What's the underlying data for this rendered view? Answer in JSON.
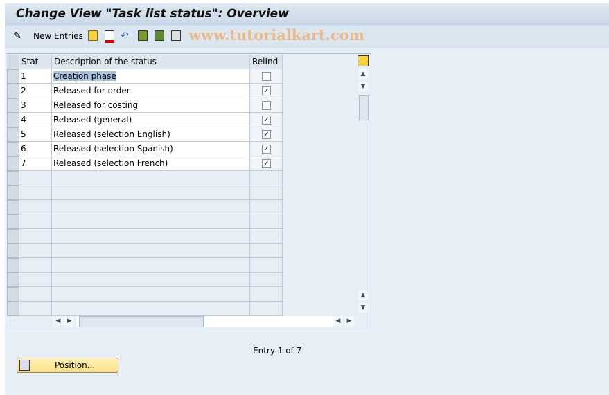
{
  "title": "Change View \"Task list status\": Overview",
  "toolbar": {
    "new_entries": "New Entries",
    "watermark": "www.tutorialkart.com"
  },
  "table": {
    "columns": [
      "Stat",
      "Description of the status",
      "RelInd"
    ],
    "rows": [
      {
        "stat": "1",
        "desc": "Creation phase",
        "relind": false
      },
      {
        "stat": "2",
        "desc": "Released for order",
        "relind": true
      },
      {
        "stat": "3",
        "desc": "Released for costing",
        "relind": false
      },
      {
        "stat": "4",
        "desc": "Released (general)",
        "relind": true
      },
      {
        "stat": "5",
        "desc": "Released (selection English)",
        "relind": true
      },
      {
        "stat": "6",
        "desc": "Released (selection Spanish)",
        "relind": true
      },
      {
        "stat": "7",
        "desc": "Released (selection French)",
        "relind": true
      }
    ]
  },
  "entry_info": "Entry 1 of 7",
  "position_button": "Position..."
}
